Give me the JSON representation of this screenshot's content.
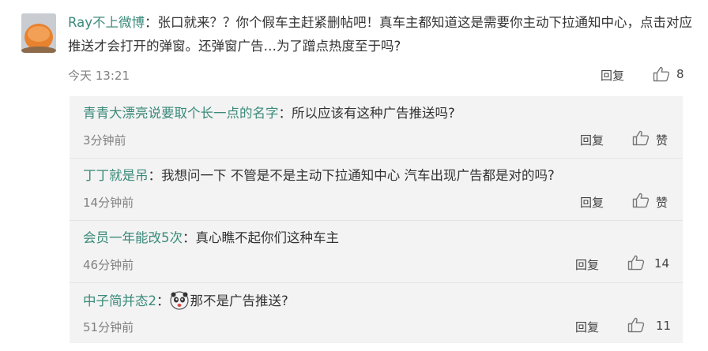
{
  "main_comment": {
    "username": "Ray不上微博",
    "colon": "：",
    "text": "张口就来？？你个假车主赶紧删帖吧！真车主都知道这是需要你主动下拉通知中心，点击对应推送才会打开的弹窗。还弹窗广告…为了蹭点热度至于吗?",
    "time": "今天 13:21",
    "reply_label": "回复",
    "like_count": "8"
  },
  "replies": [
    {
      "username": "青青大漂亮说要取个长一点的名字",
      "colon": "：",
      "text": "所以应该有这种广告推送吗?",
      "time": "3分钟前",
      "reply_label": "回复",
      "like_label": "赞"
    },
    {
      "username": "丁丁就是吊",
      "colon": "：",
      "text": "我想问一下 不管是不是主动下拉通知中心  汽车出现广告都是对的吗?",
      "time": "14分钟前",
      "reply_label": "回复",
      "like_label": "赞"
    },
    {
      "username": "会员一年能改5次",
      "colon": "：",
      "text": "真心瞧不起你们这种车主",
      "time": "46分钟前",
      "reply_label": "回复",
      "like_label": "14"
    },
    {
      "username": "中子简并态2",
      "colon": "：",
      "text": "那不是广告推送?",
      "time": "51分钟前",
      "reply_label": "回复",
      "like_label": "11"
    }
  ],
  "icons": {
    "like": "thumbs-up-icon",
    "emoji": "panda-emoji-icon"
  },
  "colors": {
    "username": "#3a8a7a",
    "text": "#333333",
    "meta": "#808080",
    "reply_bg": "#f3f3f3"
  }
}
